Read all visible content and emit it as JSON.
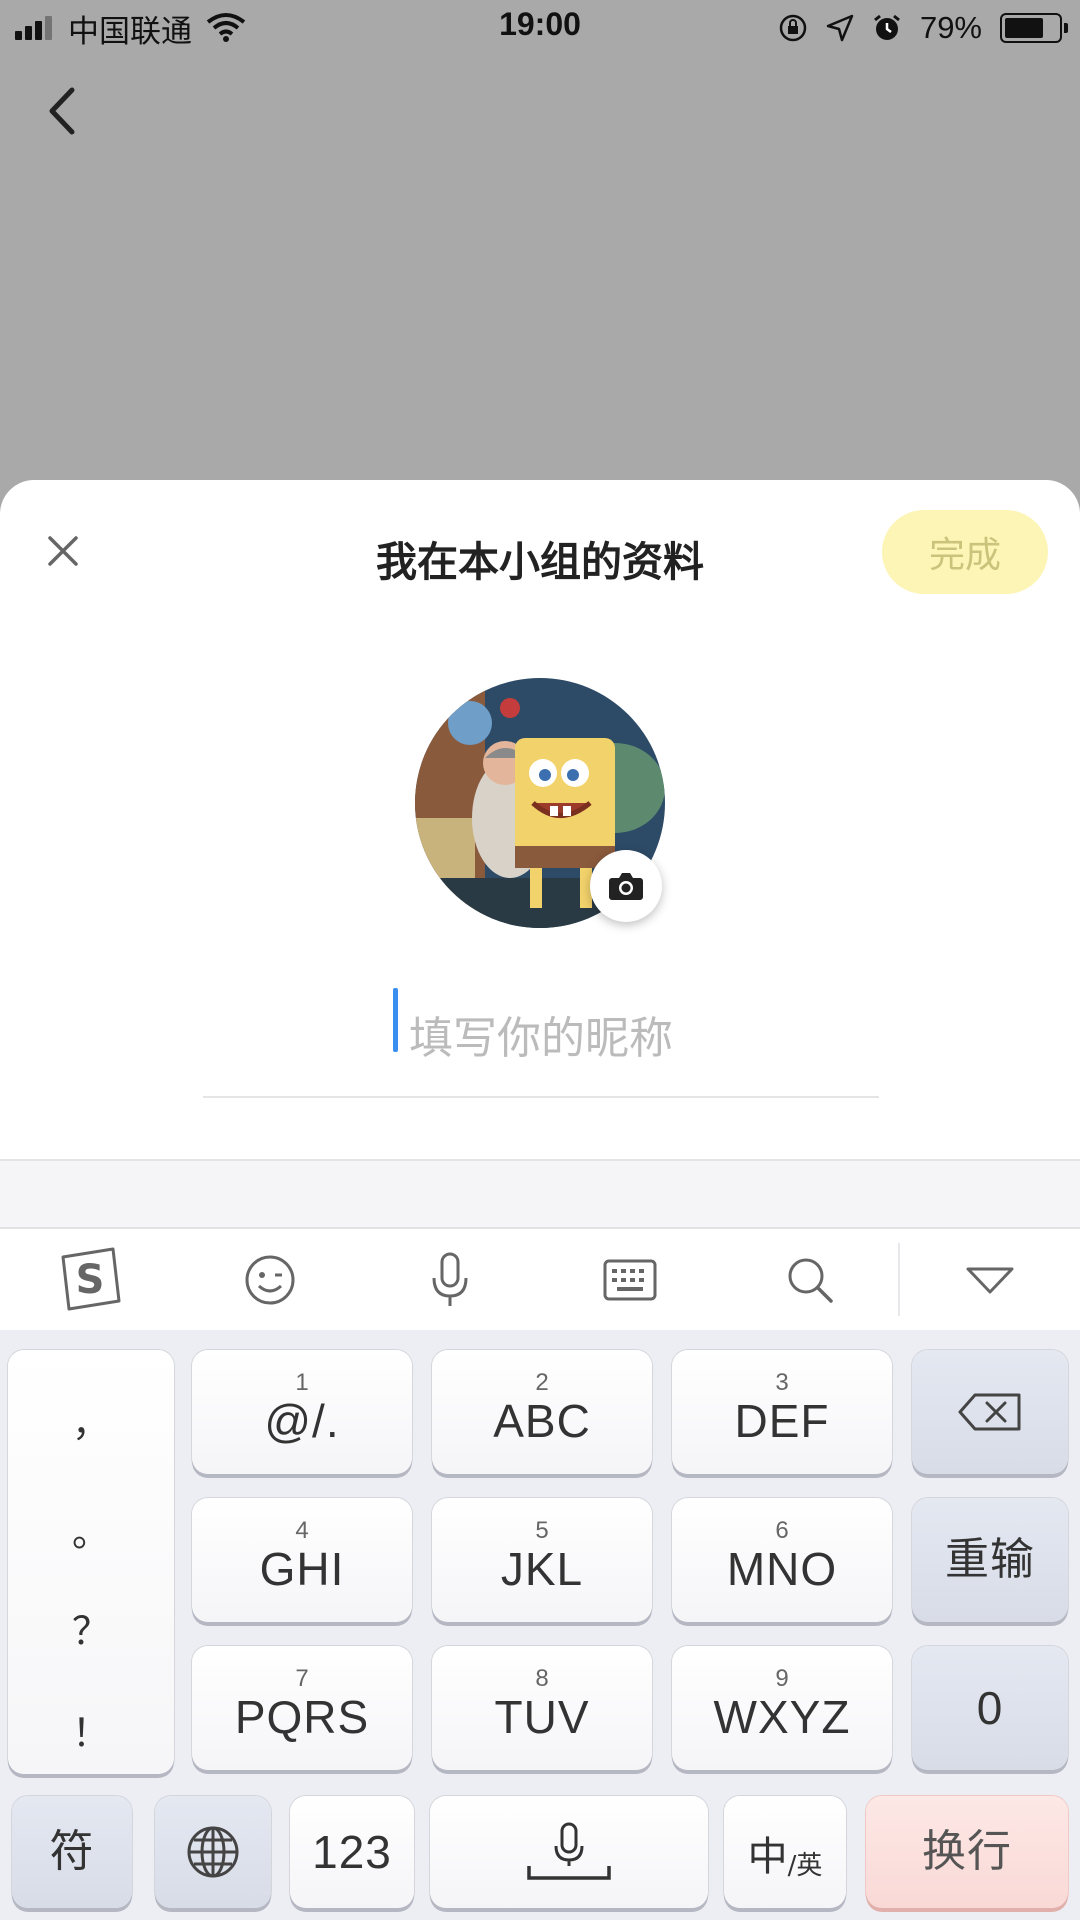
{
  "status_bar": {
    "carrier": "中国联通",
    "time": "19:00",
    "battery": "79%",
    "battery_level": 0.79
  },
  "sheet": {
    "title": "我在本小组的资料",
    "done_label": "完成",
    "nickname_placeholder": "填写你的昵称",
    "nickname_value": ""
  },
  "keyboard": {
    "toolbar": [
      {
        "name": "sogou-logo-icon"
      },
      {
        "name": "emoji-icon"
      },
      {
        "name": "microphone-icon"
      },
      {
        "name": "keyboard-icon"
      },
      {
        "name": "search-icon"
      },
      {
        "name": "collapse-keyboard-icon"
      }
    ],
    "punctuation": [
      "，",
      "。",
      "？",
      "！"
    ],
    "keys": [
      {
        "num": "1",
        "label": "@/."
      },
      {
        "num": "2",
        "label": "ABC"
      },
      {
        "num": "3",
        "label": "DEF"
      },
      {
        "num": "4",
        "label": "GHI"
      },
      {
        "num": "5",
        "label": "JKL"
      },
      {
        "num": "6",
        "label": "MNO"
      },
      {
        "num": "7",
        "label": "PQRS"
      },
      {
        "num": "8",
        "label": "TUV"
      },
      {
        "num": "9",
        "label": "WXYZ"
      }
    ],
    "reset_label": "重输",
    "zero_label": "0",
    "symbol_label": "符",
    "num_label": "123",
    "lang_main": "中",
    "lang_sub": "/英",
    "enter_label": "换行",
    "accent_color": "#fdf5b6"
  }
}
